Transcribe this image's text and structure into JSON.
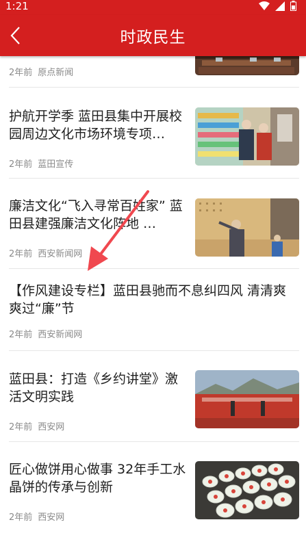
{
  "status": {
    "time": "1:21"
  },
  "appbar": {
    "title": "时政民生"
  },
  "articles": [
    {
      "title": "",
      "age": "2年前",
      "source": "原点新闻"
    },
    {
      "title": "护航开学季  蓝田县集中开展校园周边文化市场环境专项…",
      "age": "2年前",
      "source": "蓝田宣传"
    },
    {
      "title": "廉洁文化“飞入寻常百姓家”  蓝田县建强廉洁文化阵地  …",
      "age": "2年前",
      "source": "西安新闻网"
    },
    {
      "title": "【作风建设专栏】蓝田县驰而不息纠四风  清清爽爽过“廉”节",
      "age": "2年前",
      "source": "西安新闻网"
    },
    {
      "title": "蓝田县：打造《乡约讲堂》激活文明实践",
      "age": "2年前",
      "source": "西安网"
    },
    {
      "title": "匠心做饼用心做事  32年手工水晶饼的传承与创新",
      "age": "2年前",
      "source": "西安网"
    }
  ],
  "colors": {
    "accent": "#d41f1f",
    "annotation_arrow": "#f0484f"
  }
}
